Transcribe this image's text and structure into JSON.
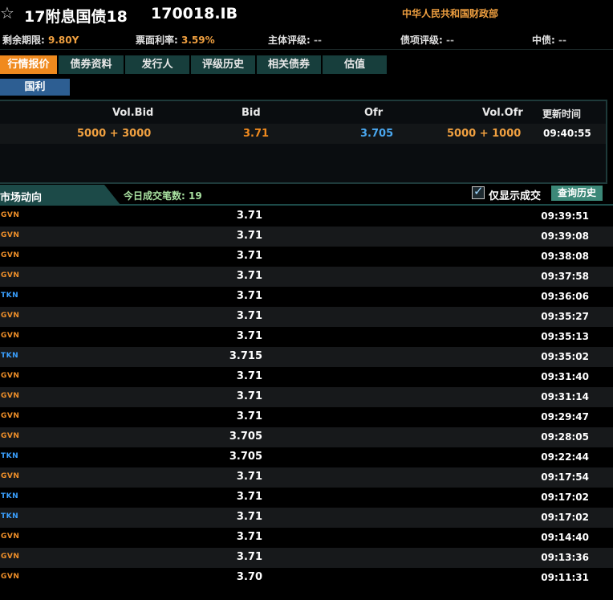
{
  "header": {
    "star_icon": "☆",
    "bond_name": "17附息国债18",
    "bond_code": "170018.IB",
    "issuer": "中华人民共和国财政部"
  },
  "info": {
    "remaining_label": "剩余期限:",
    "remaining_value": "9.80Y",
    "coupon_label": "票面利率:",
    "coupon_value": "3.59%",
    "issuer_rating_label": "主体评级:",
    "issuer_rating_value": "--",
    "bond_rating_label": "债项评级:",
    "bond_rating_value": "--",
    "cb_label": "中债:",
    "cb_value": "--"
  },
  "tabs": [
    {
      "label": "行情报价",
      "active": true
    },
    {
      "label": "债券资料",
      "active": false
    },
    {
      "label": "发行人",
      "active": false
    },
    {
      "label": "评级历史",
      "active": false
    },
    {
      "label": "相关债券",
      "active": false
    },
    {
      "label": "估值",
      "active": false
    }
  ],
  "subtab": {
    "label": "国利"
  },
  "quote": {
    "headers": {
      "vol_bid": "Vol.Bid",
      "bid": "Bid",
      "ofr": "Ofr",
      "vol_ofr": "Vol.Ofr",
      "time": "更新时间"
    },
    "row": {
      "vol_bid": "5000 + 3000",
      "bid": "3.71",
      "ofr": "3.705",
      "vol_ofr": "5000 + 1000",
      "time": "09:40:55"
    }
  },
  "market": {
    "title": "市场动向",
    "count_label": "今日成交笔数: 19",
    "only_trades_label": "仅显示成交",
    "only_trades_checked": true,
    "history_button": "查询历史"
  },
  "colors": {
    "accent": "#f08a1e",
    "gvn": "#f0902a",
    "tkn": "#3aa0ff",
    "tab_bg": "#173e3c"
  },
  "trades": [
    {
      "side": "GVN",
      "price": "3.71",
      "time": "09:39:51"
    },
    {
      "side": "GVN",
      "price": "3.71",
      "time": "09:39:08"
    },
    {
      "side": "GVN",
      "price": "3.71",
      "time": "09:38:08"
    },
    {
      "side": "GVN",
      "price": "3.71",
      "time": "09:37:58"
    },
    {
      "side": "TKN",
      "price": "3.71",
      "time": "09:36:06"
    },
    {
      "side": "GVN",
      "price": "3.71",
      "time": "09:35:27"
    },
    {
      "side": "GVN",
      "price": "3.71",
      "time": "09:35:13"
    },
    {
      "side": "TKN",
      "price": "3.715",
      "time": "09:35:02"
    },
    {
      "side": "GVN",
      "price": "3.71",
      "time": "09:31:40"
    },
    {
      "side": "GVN",
      "price": "3.71",
      "time": "09:31:14"
    },
    {
      "side": "GVN",
      "price": "3.71",
      "time": "09:29:47"
    },
    {
      "side": "GVN",
      "price": "3.705",
      "time": "09:28:05"
    },
    {
      "side": "TKN",
      "price": "3.705",
      "time": "09:22:44"
    },
    {
      "side": "GVN",
      "price": "3.71",
      "time": "09:17:54"
    },
    {
      "side": "TKN",
      "price": "3.71",
      "time": "09:17:02"
    },
    {
      "side": "TKN",
      "price": "3.71",
      "time": "09:17:02"
    },
    {
      "side": "GVN",
      "price": "3.71",
      "time": "09:14:40"
    },
    {
      "side": "GVN",
      "price": "3.71",
      "time": "09:13:36"
    },
    {
      "side": "GVN",
      "price": "3.70",
      "time": "09:11:31"
    }
  ]
}
